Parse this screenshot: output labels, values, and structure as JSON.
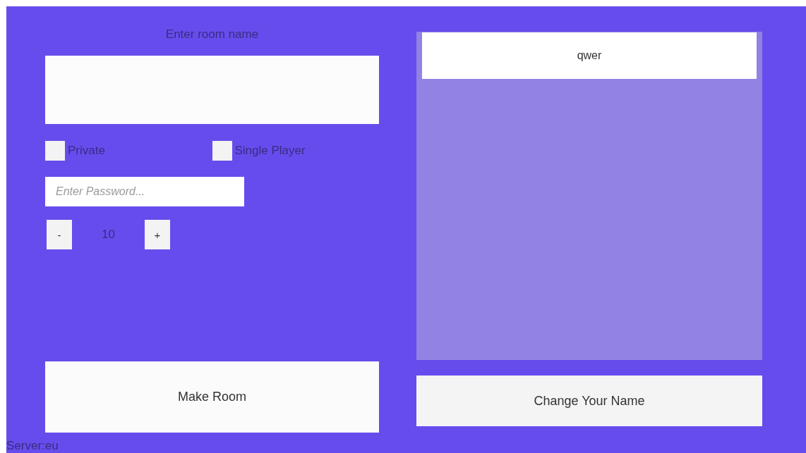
{
  "create_room": {
    "title": "Enter room name",
    "options": [
      {
        "label": "Private",
        "checked": false
      },
      {
        "label": "Single Player",
        "checked": false
      }
    ],
    "password": {
      "placeholder": "Enter Password..."
    },
    "player_count": {
      "decrement": "-",
      "value": "10",
      "increment": "+"
    },
    "make_button": "Make Room"
  },
  "room_list": {
    "rooms": [
      {
        "name": "qwer"
      }
    ]
  },
  "change_name_button": "Change Your Name",
  "status_bar": "Server:eu"
}
